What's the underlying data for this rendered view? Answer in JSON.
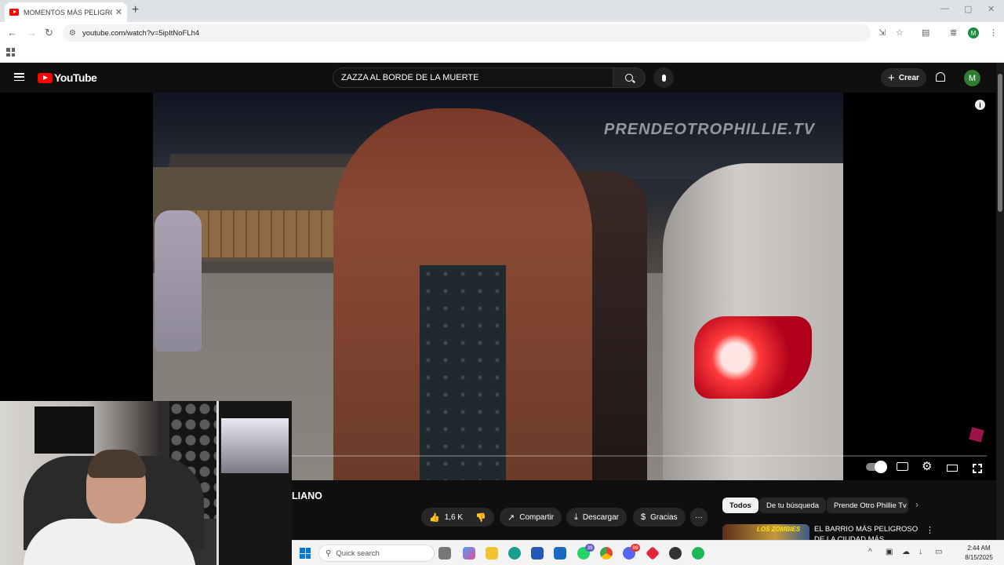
{
  "browser": {
    "tab_title": "MOMENTOS MÁS PELIGROSOS",
    "tab_close": "✕",
    "new_tab": "+",
    "url": "youtube.com/watch?v=5ipItNoFLh4",
    "window_controls": [
      "—",
      "▢",
      "✕"
    ]
  },
  "youtube": {
    "logo_text": "YouTube",
    "search_query": "ZAZZA AL BORDE DE LA MUERTE",
    "create_label": "Crear",
    "avatar_letter": "M",
    "accent_red": "#ff0000"
  },
  "player": {
    "watermark": "PRENDEOTROPHILLIE.TV",
    "info_glyph": "i"
  },
  "video": {
    "title_fragment": "LIANO",
    "like_count": "1,6 K",
    "share_label": "Compartir",
    "download_label": "Descargar",
    "thanks_label": "Gracias",
    "more_glyph": "···"
  },
  "chips": [
    "Todos",
    "De tu búsqueda",
    "Prende Otro Phillie Tv"
  ],
  "recommendation": {
    "thumb_text": "LOS ZOMBIES",
    "title": "EL BARRIO MÁS PELIGROSO DE LA CIUDAD MÁS PELIGROSA"
  },
  "taskbar": {
    "search_placeholder": "Quick search",
    "whatsapp_badge": "39",
    "discord_badge": "99",
    "time": "2:44 AM",
    "date": "8/15/2025"
  }
}
